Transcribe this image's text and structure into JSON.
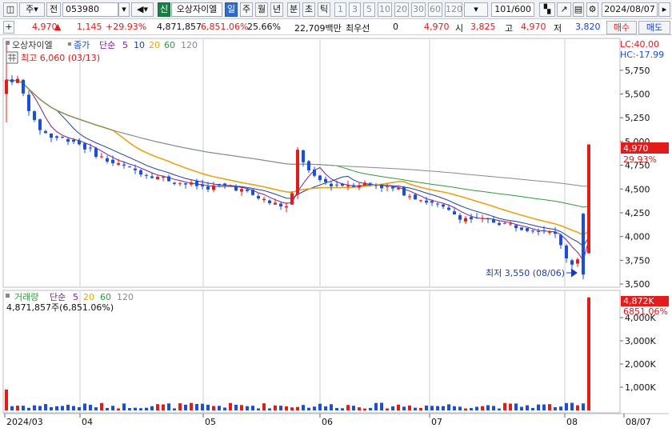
{
  "toolbar": {
    "menu_label": "주",
    "all_label": "전",
    "code": "053980",
    "shin_label": "신",
    "stock_name": "오상자이엘",
    "periods": [
      "일",
      "주",
      "월",
      "년",
      "분",
      "초",
      "틱"
    ],
    "numbers": [
      "1",
      "3",
      "5",
      "10",
      "20",
      "30",
      "60",
      "120"
    ],
    "count": "101/600",
    "date": "2024/08/07"
  },
  "quote": {
    "price": "4,970",
    "change": "1,145",
    "change_pct": "+29.93%",
    "volume": "4,871,857",
    "volume_pct": "6,851.06%",
    "turnover": "25.66%",
    "amount": "22,709백만",
    "pref_label": "최우선",
    "pref_value": "0",
    "pref_price": "4,970",
    "open_label": "시",
    "open": "3,825",
    "high_label": "고",
    "high": "4,970",
    "low_label": "저",
    "low": "3,820",
    "buy_label": "매수",
    "sell_label": "매도"
  },
  "price_panel": {
    "legend_name": "오상자이엘",
    "legend_close": "종가",
    "legend_ma_type": "단순",
    "legend_ma": [
      "5",
      "10",
      "20",
      "60",
      "120"
    ],
    "max_annotation": "최고 6,060 (03/13)",
    "min_annotation": "최저 3,550 (08/06)",
    "lc_label": "LC:40.00",
    "hc_label": "HC:-17.99",
    "current_price": "4,970",
    "current_pct": "29.93%",
    "y_ticks": [
      "5,750",
      "5,500",
      "5,250",
      "5,000",
      "4,750",
      "4,500",
      "4,250",
      "4,000",
      "3,750",
      "3,500"
    ]
  },
  "volume_panel": {
    "legend_name": "거래량",
    "legend_ma_type": "단순",
    "legend_ma": [
      "5",
      "20",
      "60",
      "120"
    ],
    "value_label": "4,871,857주(6,851.06%)",
    "current_value": "4,872K",
    "current_pct": "6851.06%",
    "y_ticks": [
      "4,000K",
      "3,000K",
      "2,000K",
      "1,000K"
    ]
  },
  "x_axis": {
    "labels": [
      "2024/03",
      "04",
      "05",
      "06",
      "07",
      "08",
      "08/07"
    ]
  },
  "colors": {
    "up": "#e21b1b",
    "down": "#1b4fd8",
    "ma5": "#7a1fa2",
    "ma10": "#1f3fa8",
    "ma20": "#e8a317",
    "ma60": "#2e9a3a",
    "ma120": "#888888"
  },
  "chart_data": {
    "type": "candlestick",
    "price_start": 5650,
    "price_end": 4970,
    "price_max": 6060,
    "price_min": 3550,
    "last_open": 3825,
    "last_high": 4970,
    "last_low": 3820,
    "last_close": 4970,
    "last_volume": 4871857,
    "ylim": [
      3450,
      6060
    ]
  }
}
